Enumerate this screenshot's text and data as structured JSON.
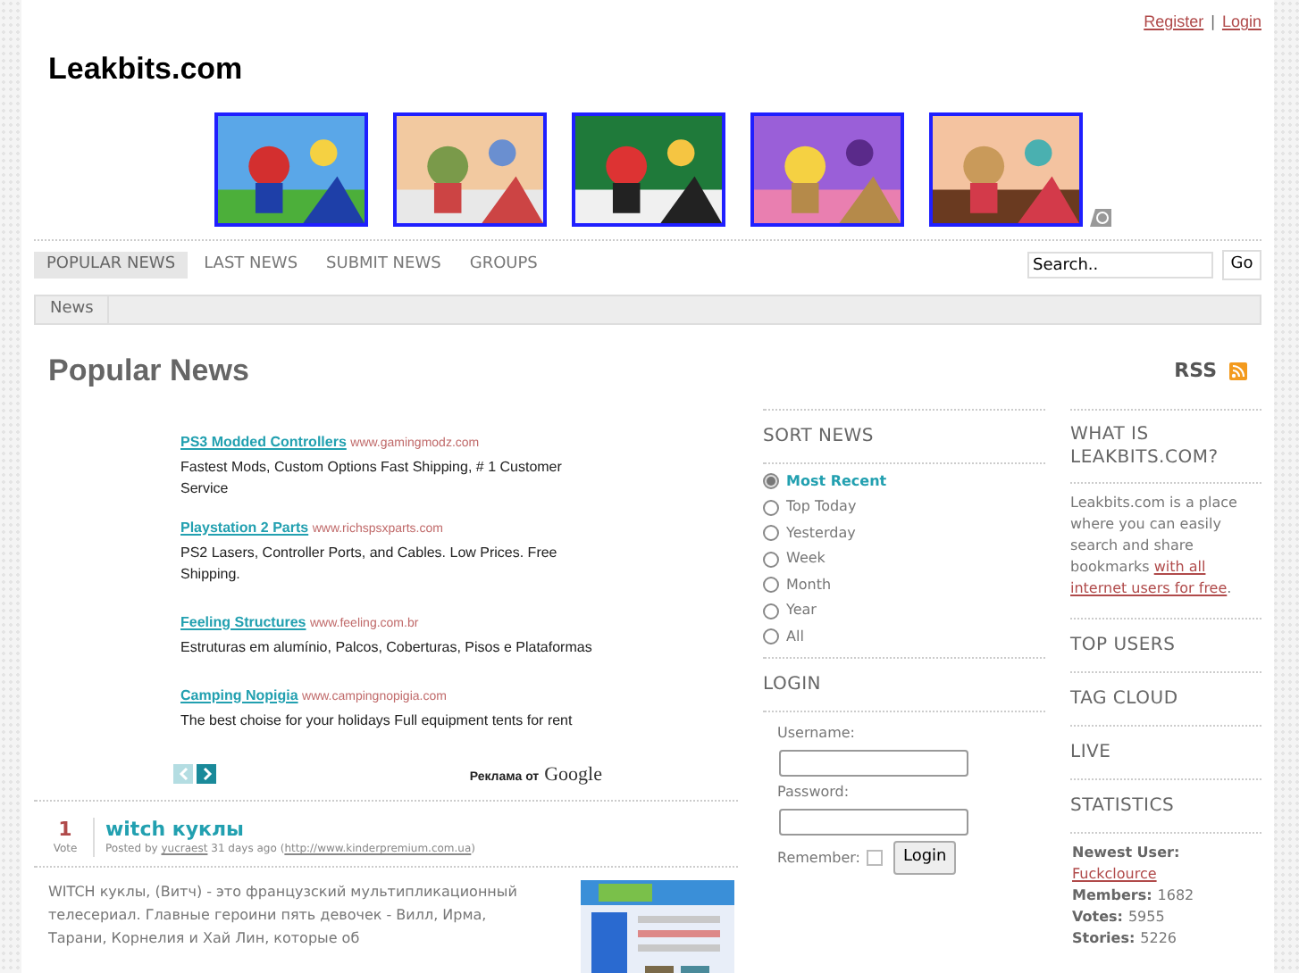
{
  "header": {
    "links": [
      "Register",
      "Login"
    ],
    "separator": "|",
    "site_title": "Leakbits.com",
    "thumbnails": [
      {
        "kind": "picture"
      },
      {
        "kind": "picture"
      },
      {
        "kind": "picture"
      },
      {
        "kind": "picture"
      },
      {
        "kind": "picture"
      }
    ]
  },
  "nav": {
    "items": [
      {
        "label": "POPULAR NEWS",
        "selected": true
      },
      {
        "label": "LAST NEWS",
        "selected": false
      },
      {
        "label": "SUBMIT NEWS",
        "selected": false
      },
      {
        "label": "GROUPS",
        "selected": false
      }
    ],
    "search": {
      "value": "Search.."
    },
    "go": "Go"
  },
  "breadcrumb": [
    "News"
  ],
  "page_title": "Popular News",
  "rss": "RSS",
  "ads": {
    "items": [
      {
        "title": "PS3 Modded Controllers",
        "url": "www.gamingmodz.com",
        "text": "Fastest Mods, Custom Options Fast Shipping, # 1 Customer Service"
      },
      {
        "title": "Playstation 2 Parts",
        "url": "www.richspsxparts.com",
        "text": "PS2 Lasers, Controller Ports, and Cables. Low Prices. Free Shipping."
      },
      {
        "title": "Feeling Structures",
        "url": "www.feeling.com.br",
        "text": "Estruturas em alumínio, Palcos, Coberturas, Pisos e Plataformas"
      },
      {
        "title": "Camping Nopigia",
        "url": "www.campingnopigia.com",
        "text": "The best choise for your holidays Full equipment tents for rent"
      }
    ],
    "prev_enabled": false,
    "next_enabled": true,
    "ads_by": "Реклама от",
    "brand": "Google"
  },
  "story": {
    "votes": "1",
    "votes_label": "Vote",
    "title": "witch куклы",
    "posted_by": "Posted by",
    "user": "yucraest",
    "age": "31 days ago",
    "open": "(",
    "link": "http://www.kinderpremium.com.ua",
    "close": ")",
    "excerpt": "WITCH куклы, (Витч) - это французский мультипликационный телесериал. Главные героини пять девочек - Вилл, Ирма, Тарани, Корнелия и Хай Лин, которые об",
    "thumbnail": {
      "kind": "picture"
    }
  },
  "sort_news": {
    "title": "SORT NEWS",
    "options": [
      {
        "label": "Most Recent",
        "selected": true
      },
      {
        "label": "Top Today",
        "selected": false
      },
      {
        "label": "Yesterday",
        "selected": false
      },
      {
        "label": "Week",
        "selected": false
      },
      {
        "label": "Month",
        "selected": false
      },
      {
        "label": "Year",
        "selected": false
      },
      {
        "label": "All",
        "selected": false
      }
    ]
  },
  "login": {
    "title": "LOGIN",
    "username_label": "Username:",
    "password_label": "Password:",
    "remember_label": "Remember:",
    "remember": false,
    "button": "Login"
  },
  "about": {
    "title": "WHAT IS LEAKBITS.COM?",
    "text": "Leakbits.com is a place where you can easily search and share bookmarks",
    "link_lines": [
      "with all",
      "internet users for free"
    ],
    "end": "."
  },
  "side_sections": [
    "TOP USERS",
    "TAG CLOUD",
    "LIVE"
  ],
  "statistics": {
    "title": "STATISTICS",
    "newest_label": "Newest User:",
    "newest_user": "Fuckclource",
    "rows": [
      {
        "label": "Members:",
        "value": "1682"
      },
      {
        "label": "Votes:",
        "value": "5955"
      },
      {
        "label": "Stories:",
        "value": "5226"
      }
    ]
  }
}
